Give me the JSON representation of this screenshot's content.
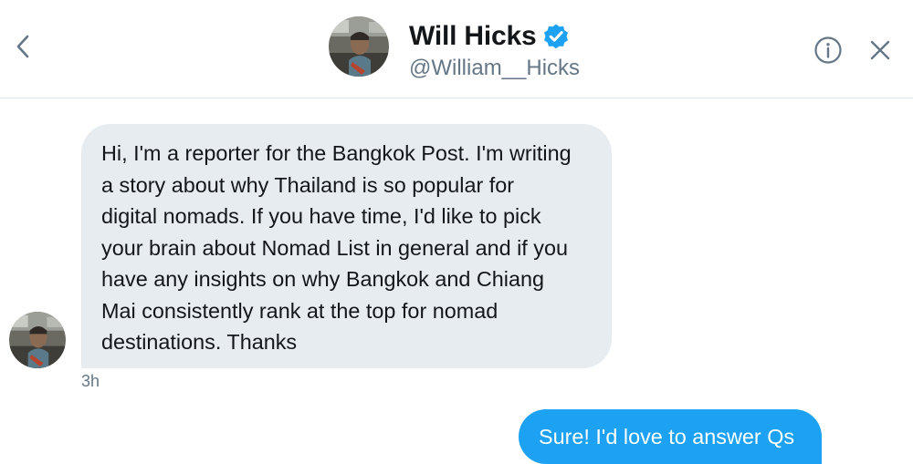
{
  "header": {
    "display_name": "Will Hicks",
    "handle": "@William__Hicks",
    "verified": true
  },
  "icons": {
    "back": "chevron-left-icon",
    "verified": "verified-badge-icon",
    "info": "info-icon",
    "close": "close-icon"
  },
  "colors": {
    "accent": "#1da1f2",
    "incoming_bubble": "#e6ecf0",
    "secondary_text": "#657786",
    "primary_text": "#14171a"
  },
  "messages": [
    {
      "direction": "incoming",
      "lines": [
        "Hi, I'm a reporter for the Bangkok Post. I'm writing",
        "a story about why Thailand is so popular for",
        "digital nomads. If you have time, I'd like to pick",
        "your brain about Nomad List in general and if you",
        "have any insights on why Bangkok and Chiang",
        "Mai consistently rank at the top for nomad",
        "destinations. Thanks"
      ],
      "time": "3h"
    },
    {
      "direction": "outgoing",
      "text": "Sure! I'd love to answer Qs"
    }
  ]
}
